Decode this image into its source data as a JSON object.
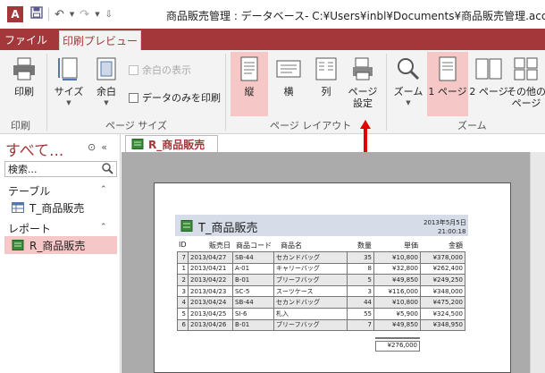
{
  "titlebar": {
    "app_letter": "A",
    "title": "商品販売管理 : データベース- C:¥Users¥inbl¥Documents¥商品販売管理.accdb"
  },
  "tabs": {
    "file": "ファイル",
    "print_preview": "印刷プレビュー"
  },
  "ribbon": {
    "print": "印刷",
    "size": "サイズ",
    "margin": "余白",
    "show_margins": "余白の表示",
    "data_only": "データのみを印刷",
    "portrait": "縦",
    "landscape": "横",
    "columns": "列",
    "page_setup_1": "ページ",
    "page_setup_2": "設定",
    "zoom": "ズーム",
    "one_page": "1 ページ",
    "two_page": "2 ページ",
    "other_1": "その他の",
    "other_2": "ページ",
    "group_print": "印刷",
    "group_page_size": "ページ サイズ",
    "group_page_layout": "ページ レイアウト",
    "group_zoom": "ズーム"
  },
  "nav": {
    "header": "すべて...",
    "search_placeholder": "検索...",
    "cat_tables": "テーブル",
    "table_item": "T_商品販売",
    "cat_reports": "レポート",
    "report_item": "R_商品販売"
  },
  "doc_tab": "R_商品販売",
  "report": {
    "title": "T_商品販売",
    "date": "2013年5月5日",
    "time": "21:00:18",
    "headers": [
      "ID",
      "販売日",
      "商品コード",
      "商品名",
      "数量",
      "単価",
      "金額"
    ],
    "rows": [
      [
        "7",
        "2013/04/27",
        "SB-44",
        "セカンドバッグ",
        "35",
        "¥10,800",
        "¥378,000"
      ],
      [
        "1",
        "2013/04/21",
        "A-01",
        "キャリーバッグ",
        "8",
        "¥32,800",
        "¥262,400"
      ],
      [
        "2",
        "2013/04/22",
        "B-01",
        "ブリーフバッグ",
        "5",
        "¥49,850",
        "¥249,250"
      ],
      [
        "3",
        "2013/04/23",
        "SC-5",
        "スーツケース",
        "3",
        "¥116,000",
        "¥348,000"
      ],
      [
        "4",
        "2013/04/24",
        "SB-44",
        "セカンドバッグ",
        "44",
        "¥10,800",
        "¥475,200"
      ],
      [
        "5",
        "2013/04/25",
        "SI-6",
        "札入",
        "55",
        "¥5,900",
        "¥324,500"
      ],
      [
        "6",
        "2013/04/26",
        "B-01",
        "ブリーフバッグ",
        "7",
        "¥49,850",
        "¥348,950"
      ]
    ],
    "total": "¥276,000"
  }
}
